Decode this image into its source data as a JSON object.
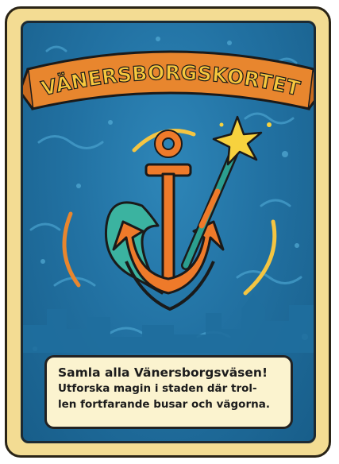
{
  "card": {
    "title": "VÄNERSBORGSKORTET",
    "headline": "Samla alla Vänersborgsväsen!",
    "body_lines": [
      "Utforska magin i staden där trol-",
      "len fortfarande busar och vägorna."
    ]
  },
  "icons": [
    "anchor-icon",
    "wave-icon",
    "magic-wand-icon",
    "sparkle-icon"
  ],
  "colors": {
    "frame": "#f3dc93",
    "background": "#2272a3",
    "banner": "#e8862e",
    "title_text": "#f7c73d",
    "anchor": "#ee7a2a",
    "wave": "#3bb3a0",
    "text_box": "#fbf3cf"
  }
}
